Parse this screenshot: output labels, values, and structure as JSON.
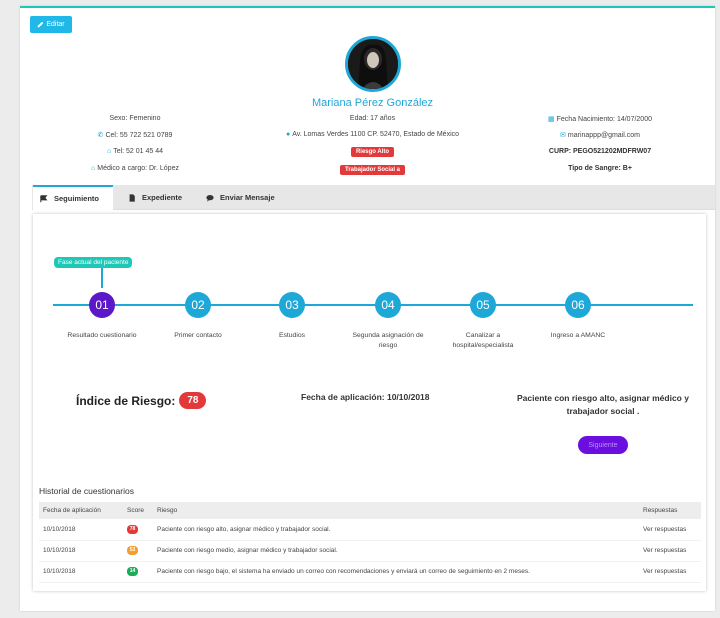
{
  "header": {
    "edit_label": "Editar"
  },
  "patient": {
    "name": "Mariana Pérez González",
    "sexo": "Sexo: Femenino",
    "cel": "Cel: 55 722 521 0789",
    "tel": "Tel: 52 01 45 44",
    "medico": "Médico a cargo: Dr. López",
    "edad": "Edad: 17 años",
    "direccion": "Av. Lomas Verdes 1100 CP. 52470, Estado de México",
    "riesgo_badge": "Riesgo Alto",
    "trabajador_badge": "Trabajador Social a",
    "fecha_nac": "Fecha Nacimiento: 14/07/2000",
    "email": "marinappp@gmail.com",
    "curp": "CURP: PEGO521202MDFRW07",
    "sangre": "Tipo de Sangre: B+"
  },
  "tabs": [
    {
      "label": "Seguimiento",
      "icon": "flag-icon"
    },
    {
      "label": "Expediente",
      "icon": "file-icon"
    },
    {
      "label": "Enviar Mensaje",
      "icon": "message-icon"
    }
  ],
  "timeline": {
    "phase_tag": "Fase actual del paciente",
    "steps": [
      {
        "num": "01",
        "label": "Resultado cuestionario"
      },
      {
        "num": "02",
        "label": "Primer contacto"
      },
      {
        "num": "03",
        "label": "Estudios"
      },
      {
        "num": "04",
        "label": "Segunda asignación de riesgo"
      },
      {
        "num": "05",
        "label": "Canalizar a hospital/especialista"
      },
      {
        "num": "06",
        "label": "Ingreso a AMANC"
      }
    ]
  },
  "risk": {
    "title": "Índice de Riesgo:",
    "score": "78",
    "fecha": "Fecha de aplicación: 10/10/2018",
    "recommendation": "Paciente con riesgo alto, asignar médico y trabajador social .",
    "next_label": "Siguiente"
  },
  "history": {
    "title": "Historial de cuestionarios",
    "headers": [
      "Fecha de aplicación",
      "Score",
      "Riesgo",
      "Respuestas"
    ],
    "rows": [
      {
        "fecha": "10/10/2018",
        "score": "78",
        "color": "#e23a3a",
        "riesgo": "Paciente con riesgo alto, asignar médico y trabajador social.",
        "link": "Ver respuestas"
      },
      {
        "fecha": "10/10/2018",
        "score": "53",
        "color": "#f0a030",
        "riesgo": "Paciente con riesgo medio, asignar médico y trabajador social.",
        "link": "Ver respuestas"
      },
      {
        "fecha": "10/10/2018",
        "score": "14",
        "color": "#1eaa5a",
        "riesgo": "Paciente con riesgo bajo, el sistema ha enviado un correo con recomendaciones y enviará un correo de seguimiento en 2 meses.",
        "link": "Ver respuestas"
      }
    ]
  },
  "colors": {
    "accent": "#1ea8d8",
    "active_step": "#5b17c8",
    "teal": "#1ec8b6",
    "danger": "#e23a3a"
  }
}
